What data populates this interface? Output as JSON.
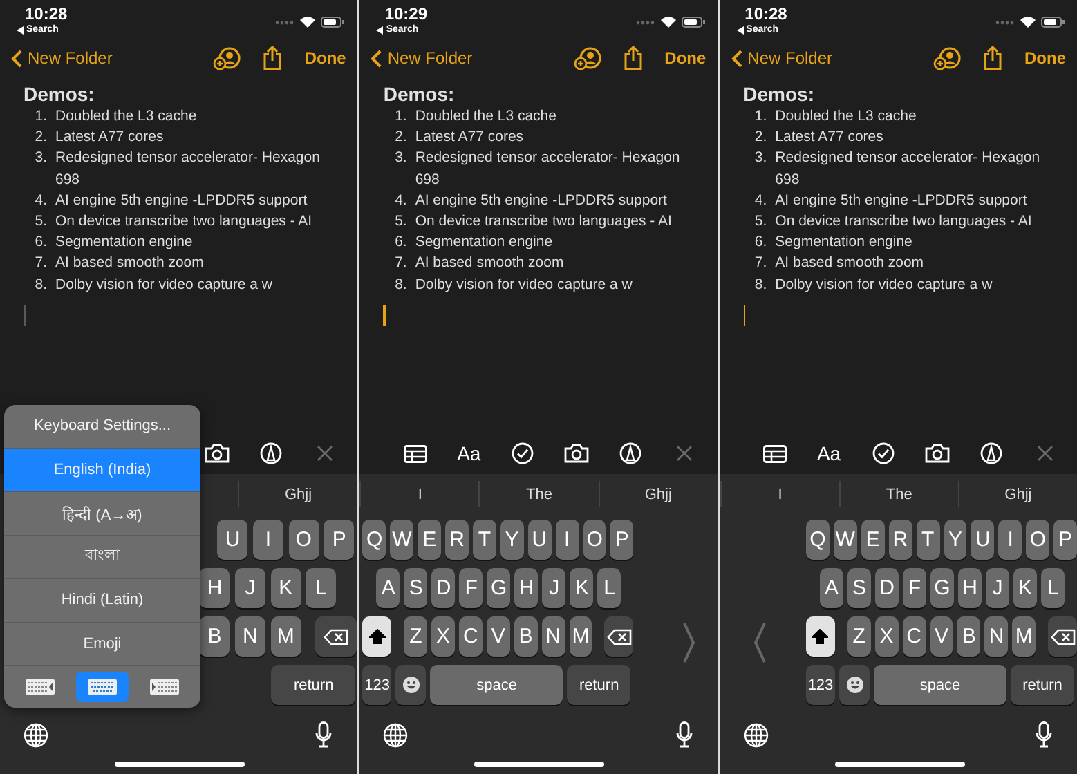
{
  "panels": [
    {
      "status": {
        "time": "10:28",
        "back": "Search"
      },
      "nav": {
        "back": "New Folder",
        "done": "Done"
      },
      "note": {
        "title": "Demos:",
        "items": [
          {
            "number": "1.",
            "text": "Doubled the L3 cache"
          },
          {
            "number": "2.",
            "text": "Latest A77 cores"
          },
          {
            "number": "3.",
            "text": "Redesigned tensor accelerator- Hexagon 698"
          },
          {
            "number": "4.",
            "text": "AI engine 5th engine -LPDDR5 support"
          },
          {
            "number": "5.",
            "text": "On device transcribe two languages - AI"
          },
          {
            "number": "6.",
            "text": "Segmentation engine"
          },
          {
            "number": "7.",
            "text": "AI based smooth zoom"
          },
          {
            "number": "8.",
            "text": "Dolby vision for video capture a w"
          }
        ]
      },
      "toolbar": [
        {
          "kind": "camera"
        },
        {
          "kind": "markup"
        },
        {
          "kind": "close"
        }
      ],
      "suggestions": [
        "Ghjj"
      ],
      "keyboard": {
        "kind": "full",
        "key_rows": [
          {
            "keys": [
              {
                "kind": "letter",
                "label": "U"
              },
              {
                "kind": "letter",
                "label": "I"
              },
              {
                "kind": "letter",
                "label": "O"
              },
              {
                "kind": "letter",
                "label": "P"
              }
            ]
          },
          {
            "keys": [
              {
                "kind": "letter",
                "label": "H"
              },
              {
                "kind": "letter",
                "label": "J"
              },
              {
                "kind": "letter",
                "label": "K"
              },
              {
                "kind": "letter",
                "label": "L"
              }
            ]
          },
          {
            "keys": [
              {
                "kind": "letter",
                "label": "B"
              },
              {
                "kind": "letter",
                "label": "N"
              },
              {
                "kind": "letter",
                "label": "M"
              },
              {
                "kind": "delete"
              }
            ]
          },
          {
            "keys": [
              {
                "kind": "return",
                "label": "return"
              }
            ]
          }
        ]
      },
      "popup": {
        "items": [
          {
            "label": "Keyboard Settings...",
            "selected": false
          },
          {
            "label": "English (India)",
            "selected": true
          },
          {
            "label": "हिन्दी (A→अ)",
            "selected": false
          },
          {
            "label": "বাংলা",
            "selected": false
          },
          {
            "label": "Hindi (Latin)",
            "selected": false
          },
          {
            "label": "Emoji",
            "selected": false
          }
        ],
        "docks": [
          {
            "kind": "left",
            "selected": false
          },
          {
            "kind": "full",
            "selected": true
          },
          {
            "kind": "right",
            "selected": false
          }
        ]
      }
    },
    {
      "status": {
        "time": "10:29",
        "back": "Search"
      },
      "nav": {
        "back": "New Folder",
        "done": "Done"
      },
      "note": {
        "title": "Demos:",
        "items": [
          {
            "number": "1.",
            "text": "Doubled the L3 cache"
          },
          {
            "number": "2.",
            "text": "Latest A77 cores"
          },
          {
            "number": "3.",
            "text": "Redesigned tensor accelerator- Hexagon 698"
          },
          {
            "number": "4.",
            "text": "AI engine 5th engine -LPDDR5 support"
          },
          {
            "number": "5.",
            "text": "On device transcribe two languages - AI"
          },
          {
            "number": "6.",
            "text": "Segmentation engine"
          },
          {
            "number": "7.",
            "text": "AI based smooth zoom"
          },
          {
            "number": "8.",
            "text": "Dolby vision for video capture a w"
          }
        ]
      },
      "toolbar": [
        {
          "kind": "table"
        },
        {
          "kind": "format",
          "label": "Aa"
        },
        {
          "kind": "checklist"
        },
        {
          "kind": "camera"
        },
        {
          "kind": "markup"
        },
        {
          "kind": "close"
        }
      ],
      "suggestions": [
        "I",
        "The",
        "Ghjj"
      ],
      "keyboard": {
        "kind": "one-handed-left",
        "shift_on": true,
        "key_rows": [
          {
            "keys": [
              {
                "kind": "letter",
                "label": "Q"
              },
              {
                "kind": "letter",
                "label": "W"
              },
              {
                "kind": "letter",
                "label": "E"
              },
              {
                "kind": "letter",
                "label": "R"
              },
              {
                "kind": "letter",
                "label": "T"
              },
              {
                "kind": "letter",
                "label": "Y"
              },
              {
                "kind": "letter",
                "label": "U"
              },
              {
                "kind": "letter",
                "label": "I"
              },
              {
                "kind": "letter",
                "label": "O"
              },
              {
                "kind": "letter",
                "label": "P"
              }
            ]
          },
          {
            "keys": [
              {
                "kind": "letter",
                "label": "A"
              },
              {
                "kind": "letter",
                "label": "S"
              },
              {
                "kind": "letter",
                "label": "D"
              },
              {
                "kind": "letter",
                "label": "F"
              },
              {
                "kind": "letter",
                "label": "G"
              },
              {
                "kind": "letter",
                "label": "H"
              },
              {
                "kind": "letter",
                "label": "J"
              },
              {
                "kind": "letter",
                "label": "K"
              },
              {
                "kind": "letter",
                "label": "L"
              }
            ]
          },
          {
            "keys": [
              {
                "kind": "shift"
              },
              {
                "kind": "letter",
                "label": "Z"
              },
              {
                "kind": "letter",
                "label": "X"
              },
              {
                "kind": "letter",
                "label": "C"
              },
              {
                "kind": "letter",
                "label": "V"
              },
              {
                "kind": "letter",
                "label": "B"
              },
              {
                "kind": "letter",
                "label": "N"
              },
              {
                "kind": "letter",
                "label": "M"
              },
              {
                "kind": "delete"
              }
            ]
          },
          {
            "keys": [
              {
                "kind": "numbers",
                "label": "123"
              },
              {
                "kind": "emoji"
              },
              {
                "kind": "space",
                "label": "space"
              },
              {
                "kind": "return",
                "label": "return"
              }
            ]
          }
        ]
      }
    },
    {
      "status": {
        "time": "10:28",
        "back": "Search"
      },
      "nav": {
        "back": "New Folder",
        "done": "Done"
      },
      "note": {
        "title": "Demos:",
        "items": [
          {
            "number": "1.",
            "text": "Doubled the L3 cache"
          },
          {
            "number": "2.",
            "text": "Latest A77 cores"
          },
          {
            "number": "3.",
            "text": "Redesigned tensor accelerator- Hexagon 698"
          },
          {
            "number": "4.",
            "text": "AI engine 5th engine -LPDDR5 support"
          },
          {
            "number": "5.",
            "text": "On device transcribe two languages - AI"
          },
          {
            "number": "6.",
            "text": "Segmentation engine"
          },
          {
            "number": "7.",
            "text": "AI based smooth zoom"
          },
          {
            "number": "8.",
            "text": "Dolby vision for video capture a w"
          }
        ]
      },
      "toolbar": [
        {
          "kind": "table"
        },
        {
          "kind": "format",
          "label": "Aa"
        },
        {
          "kind": "checklist"
        },
        {
          "kind": "camera"
        },
        {
          "kind": "markup"
        },
        {
          "kind": "close"
        }
      ],
      "suggestions": [
        "I",
        "The",
        "Ghjj"
      ],
      "keyboard": {
        "kind": "one-handed-right",
        "shift_on": true,
        "key_rows": [
          {
            "keys": [
              {
                "kind": "letter",
                "label": "Q"
              },
              {
                "kind": "letter",
                "label": "W"
              },
              {
                "kind": "letter",
                "label": "E"
              },
              {
                "kind": "letter",
                "label": "R"
              },
              {
                "kind": "letter",
                "label": "T"
              },
              {
                "kind": "letter",
                "label": "Y"
              },
              {
                "kind": "letter",
                "label": "U"
              },
              {
                "kind": "letter",
                "label": "I"
              },
              {
                "kind": "letter",
                "label": "O"
              },
              {
                "kind": "letter",
                "label": "P"
              }
            ]
          },
          {
            "keys": [
              {
                "kind": "letter",
                "label": "A"
              },
              {
                "kind": "letter",
                "label": "S"
              },
              {
                "kind": "letter",
                "label": "D"
              },
              {
                "kind": "letter",
                "label": "F"
              },
              {
                "kind": "letter",
                "label": "G"
              },
              {
                "kind": "letter",
                "label": "H"
              },
              {
                "kind": "letter",
                "label": "J"
              },
              {
                "kind": "letter",
                "label": "K"
              },
              {
                "kind": "letter",
                "label": "L"
              }
            ]
          },
          {
            "keys": [
              {
                "kind": "shift"
              },
              {
                "kind": "letter",
                "label": "Z"
              },
              {
                "kind": "letter",
                "label": "X"
              },
              {
                "kind": "letter",
                "label": "C"
              },
              {
                "kind": "letter",
                "label": "V"
              },
              {
                "kind": "letter",
                "label": "B"
              },
              {
                "kind": "letter",
                "label": "N"
              },
              {
                "kind": "letter",
                "label": "M"
              },
              {
                "kind": "delete"
              }
            ]
          },
          {
            "keys": [
              {
                "kind": "numbers",
                "label": "123"
              },
              {
                "kind": "emoji"
              },
              {
                "kind": "space",
                "label": "space"
              },
              {
                "kind": "return",
                "label": "return"
              }
            ]
          }
        ]
      }
    }
  ]
}
